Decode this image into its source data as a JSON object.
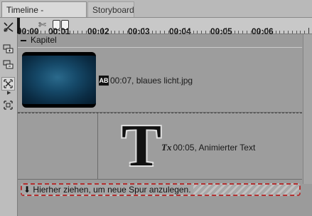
{
  "tabs": [
    {
      "label": "Timeline - Spuransicht",
      "active": true
    },
    {
      "label": "Storyboard",
      "active": false
    }
  ],
  "ruler": {
    "labels": [
      "00:00",
      "00:01",
      "00:02",
      "00:03",
      "00:04",
      "00:05",
      "00:06"
    ]
  },
  "toolbar": {
    "icons": [
      "cut-track-icon",
      "add-track-icon",
      "remove-track-icon",
      "select-mode-icon",
      "fit-icon"
    ]
  },
  "chapter": {
    "label": "Kapitel"
  },
  "tracks": [
    {
      "clip_label": "00:07, blaues licht.jpg",
      "badge": "AB"
    },
    {
      "clip_label": "00:05, Animierter Text",
      "icon_text": "Tx",
      "preview_glyph": "T"
    }
  ],
  "dropzone": {
    "label": "Hierher ziehen, um neue Spur anzulegen."
  },
  "colors": {
    "accent": "#b33030",
    "thumb_blue": "#164a6a"
  }
}
